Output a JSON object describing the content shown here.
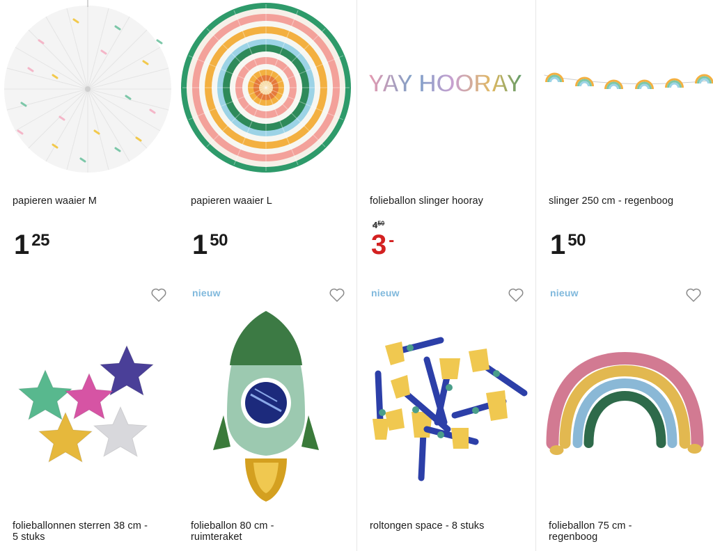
{
  "products": [
    {
      "title": "papieren waaier M",
      "price_euros": "1",
      "price_cents": "25"
    },
    {
      "title": "papieren waaier L",
      "price_euros": "1",
      "price_cents": "50"
    },
    {
      "title": "folieballon slinger hooray",
      "old_price_euros": "4",
      "old_price_cents": "50",
      "price_euros": "3",
      "price_cents": "-",
      "balloon_text": "YAY HOORAY"
    },
    {
      "title": "slinger 250 cm - regenboog",
      "price_euros": "1",
      "price_cents": "50"
    },
    {
      "title": "folieballonnen sterren 38 cm -\n5 stuks"
    },
    {
      "title": "folieballon 80 cm -\nruimteraket",
      "badge": "nieuw"
    },
    {
      "title": "roltongen space - 8 stuks",
      "badge": "nieuw"
    },
    {
      "title": "folieballon 75 cm -\nregenboog",
      "badge": "nieuw"
    }
  ],
  "colors": {
    "sale_red": "#d32121",
    "badge_blue": "#7fb8dc",
    "text": "#1a1a1a",
    "divider": "#e6e6e6"
  }
}
